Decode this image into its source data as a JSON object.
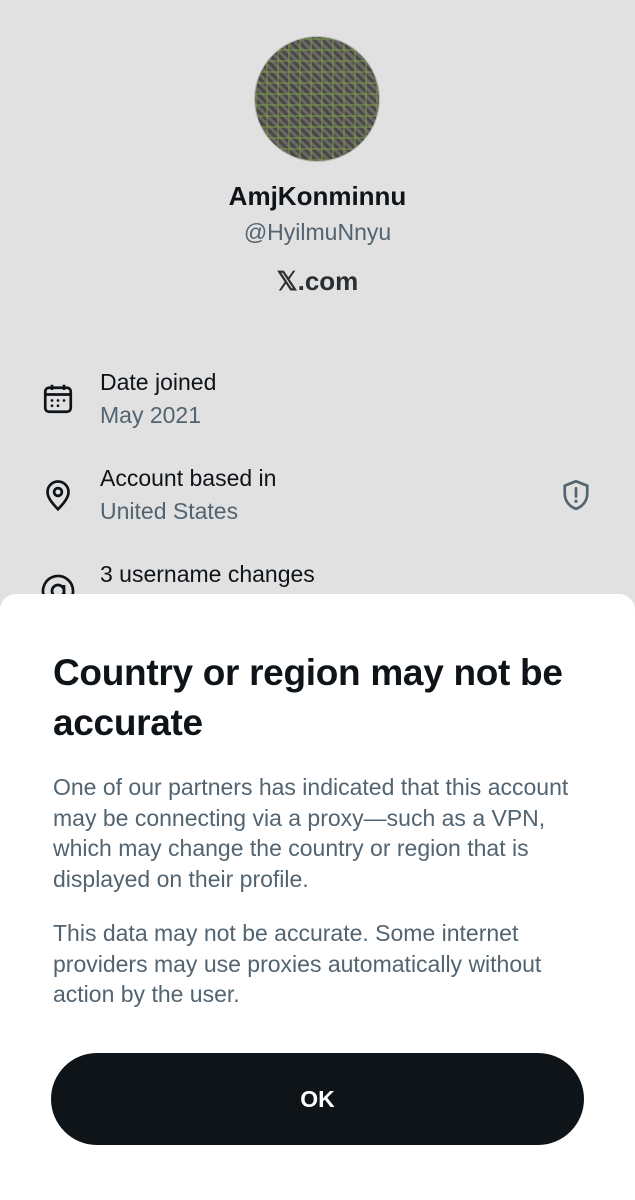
{
  "profile": {
    "display_name": "AmjKonminnu",
    "handle": "@HyilmuNnyu",
    "site": "𝕏.com",
    "avatar_icon": "avatar-pattern-image",
    "details": [
      {
        "icon": "calendar-icon",
        "title": "Date joined",
        "value": "May 2021"
      },
      {
        "icon": "location-pin-icon",
        "title": "Account based in",
        "value": "United States"
      },
      {
        "icon": "at-sign-icon",
        "title": "3 username changes"
      }
    ],
    "region_warning_icon": "shield-exclamation-icon"
  },
  "dialog": {
    "title": "Country or region may not be accurate",
    "paragraph1": "One of our partners has indicated that this account may be connecting via a proxy—such as a VPN, which may change the country or region that is displayed on their profile.",
    "paragraph2": "This data may not be accurate. Some internet providers may use proxies automatically without action by the user.",
    "ok_label": "OK"
  },
  "colors": {
    "background": "#e1e1e1",
    "primary_text": "#0f1419",
    "secondary_text": "#536471",
    "button": "#0f1419",
    "sheet": "#ffffff"
  }
}
